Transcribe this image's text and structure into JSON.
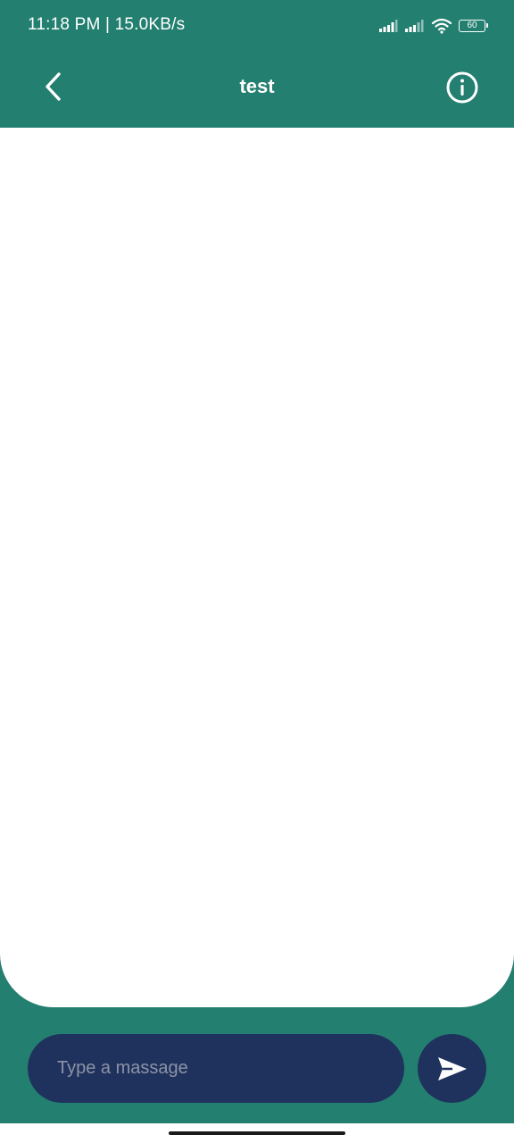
{
  "status_bar": {
    "time_speed": "11:18 PM | 15.0KB/s",
    "battery_level": "60",
    "icons": [
      "signal-icon",
      "signal-icon",
      "wifi-icon",
      "battery-icon"
    ]
  },
  "app_bar": {
    "title": "test",
    "back_icon": "chevron-left-icon",
    "info_icon": "info-circle-icon"
  },
  "composer": {
    "placeholder": "Type a massage",
    "value": "",
    "send_icon": "send-icon"
  },
  "colors": {
    "header": "#237f70",
    "input_background": "#1f325d",
    "background": "#ffffff"
  }
}
